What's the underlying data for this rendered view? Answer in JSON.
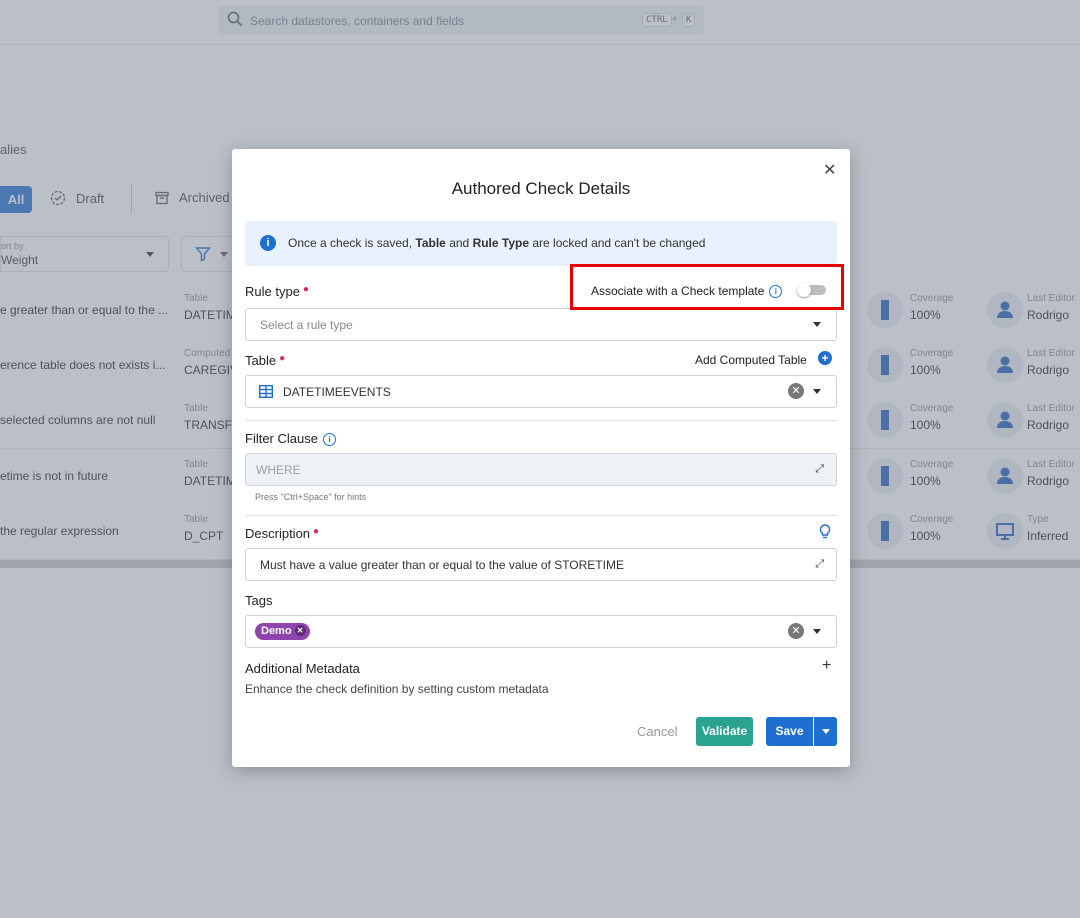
{
  "app": {
    "search_placeholder": "Search datastores, containers and fields",
    "shortcut_ctrl": "CTRL",
    "shortcut_plus": "+",
    "shortcut_key": "K"
  },
  "background": {
    "breadcrumb": "alies",
    "tabs": {
      "all": "All",
      "draft": "Draft",
      "archived": "Archived"
    },
    "sort": {
      "label": "ort by",
      "value": "Weight"
    },
    "rows": [
      {
        "name": "e greater than or equal to the ...",
        "table_label": "Table",
        "table_value": "DATETIM",
        "metric_label": "Coverage",
        "metric_value": "100%",
        "editor_label": "Last Editor",
        "editor_value": "Rodrigo"
      },
      {
        "name": "erence table does not exists i...",
        "table_label": "Computed",
        "table_value": "CAREGIV",
        "metric_label": "Coverage",
        "metric_value": "100%",
        "editor_label": "Last Editor",
        "editor_value": "Rodrigo"
      },
      {
        "name": "selected columns are not null",
        "table_label": "Table",
        "table_value": "TRANSFE",
        "metric_label": "Coverage",
        "metric_value": "100%",
        "editor_label": "Last Editor",
        "editor_value": "Rodrigo"
      },
      {
        "name": "etime is not in future",
        "table_label": "Table",
        "table_value": "DATETIM",
        "metric_label": "Coverage",
        "metric_value": "100%",
        "editor_label": "Last Editor",
        "editor_value": "Rodrigo"
      },
      {
        "name": "the regular expression",
        "table_label": "Table",
        "table_value": "D_CPT",
        "metric_label": "Coverage",
        "metric_value": "100%",
        "editor_label": "Type",
        "editor_value": "Inferred"
      }
    ]
  },
  "modal": {
    "title": "Authored Check Details",
    "info_prefix": "Once a check is saved, ",
    "info_b1": "Table",
    "info_mid": " and ",
    "info_b2": "Rule Type",
    "info_suffix": " are locked and can't be changed",
    "rule_type_label": "Rule type",
    "template_label": "Associate with a Check template",
    "template_enabled": false,
    "rule_type_placeholder": "Select a rule type",
    "table_label": "Table",
    "add_computed_label": "Add Computed Table",
    "table_value": "DATETIMEEVENTS",
    "filter_label": "Filter Clause",
    "filter_placeholder": "WHERE",
    "filter_hint": "Press \"Ctrl+Space\" for hints",
    "description_label": "Description",
    "description_value": "Must have a value greater than or equal to the value of STORETIME",
    "tags_label": "Tags",
    "tags": [
      "Demo"
    ],
    "metadata_title": "Additional Metadata",
    "metadata_sub": "Enhance the check definition by setting custom metadata",
    "cancel_label": "Cancel",
    "validate_label": "Validate",
    "save_label": "Save"
  },
  "colors": {
    "primary": "#1f6fd0",
    "validate": "#2aa390",
    "tag": "#8e44ad",
    "highlight": "#e60000"
  }
}
